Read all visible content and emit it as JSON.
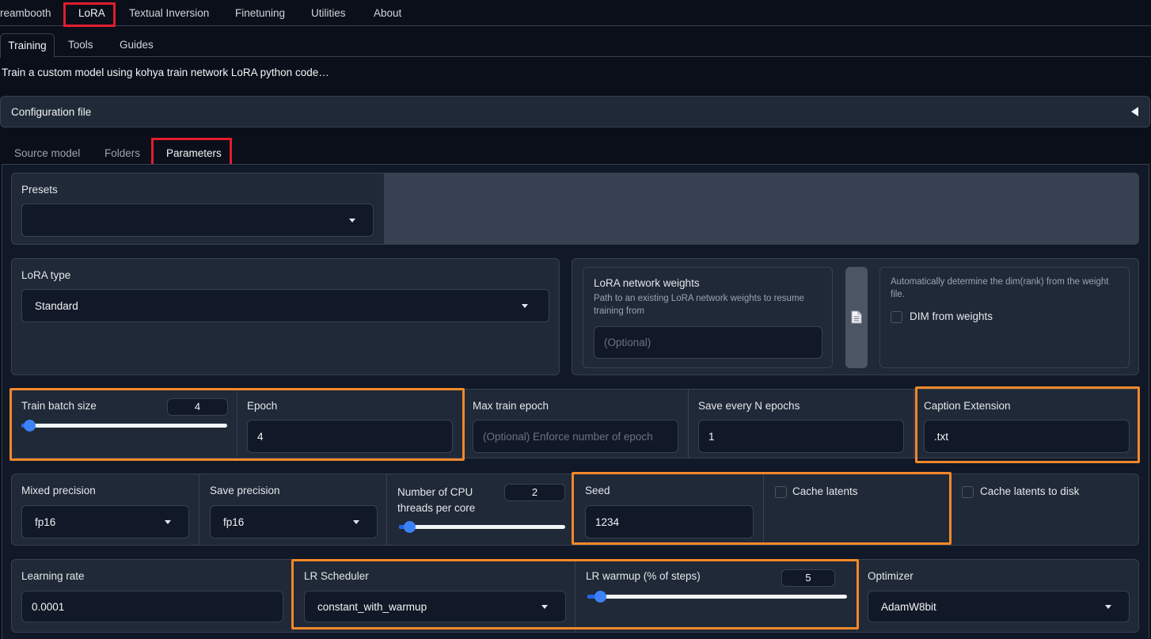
{
  "top_tabs": [
    "reambooth",
    "LoRA",
    "Textual Inversion",
    "Finetuning",
    "Utilities",
    "About"
  ],
  "sub_tabs": [
    "Training",
    "Tools",
    "Guides"
  ],
  "description": "Train a custom model using kohya train network LoRA python code…",
  "config_accordion": "Configuration file",
  "inner_tabs": [
    "Source model",
    "Folders",
    "Parameters"
  ],
  "presets": {
    "label": "Presets",
    "value": ""
  },
  "lora_type": {
    "label": "LoRA type",
    "value": "Standard"
  },
  "network_weights": {
    "label": "LoRA network weights",
    "info": "Path to an existing LoRA network weights to resume training from",
    "placeholder": "(Optional)"
  },
  "dim_from_weights": {
    "info": "Automatically determine the dim(rank) from the weight file.",
    "label": "DIM from weights"
  },
  "train_batch_size": {
    "label": "Train batch size",
    "value": "4",
    "fraction": 0.04
  },
  "epoch": {
    "label": "Epoch",
    "value": "4"
  },
  "max_train_epoch": {
    "label": "Max train epoch",
    "placeholder": "(Optional) Enforce number of epoch"
  },
  "save_every_n_epochs": {
    "label": "Save every N epochs",
    "value": "1"
  },
  "caption_extension": {
    "label": "Caption Extension",
    "value": ".txt"
  },
  "mixed_precision": {
    "label": "Mixed precision",
    "value": "fp16"
  },
  "save_precision": {
    "label": "Save precision",
    "value": "fp16"
  },
  "cpu_threads": {
    "label_line1": "Number of CPU",
    "label_line2": "threads per core",
    "value": "2",
    "fraction": 0.06
  },
  "seed": {
    "label": "Seed",
    "value": "1234"
  },
  "cache_latents": {
    "label": "Cache latents"
  },
  "cache_latents_to_disk": {
    "label": "Cache latents to disk"
  },
  "learning_rate": {
    "label": "Learning rate",
    "value": "0.0001"
  },
  "lr_scheduler": {
    "label": "LR Scheduler",
    "value": "constant_with_warmup"
  },
  "lr_warmup": {
    "label": "LR warmup (% of steps)",
    "value": "5",
    "fraction": 0.05
  },
  "optimizer": {
    "label": "Optimizer",
    "value": "AdamW8bit"
  },
  "colors": {
    "highlight_red": "#e11d2e",
    "highlight_orange": "#f2882b",
    "slider": "#3b82f6"
  }
}
